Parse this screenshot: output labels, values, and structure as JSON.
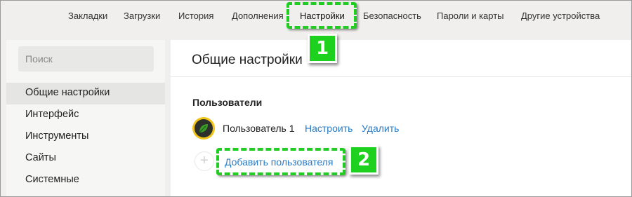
{
  "topnav": {
    "items": [
      "Закладки",
      "Загрузки",
      "История",
      "Дополнения",
      "Настройки",
      "Безопасность",
      "Пароли и карты",
      "Другие устройства"
    ],
    "active": "Настройки"
  },
  "sidebar": {
    "search_placeholder": "Поиск",
    "items": [
      "Общие настройки",
      "Интерфейс",
      "Инструменты",
      "Сайты",
      "Системные"
    ],
    "active": "Общие настройки"
  },
  "main": {
    "title": "Общие настройки",
    "users_section": {
      "title": "Пользователи",
      "user_name": "Пользователь 1",
      "configure_label": "Настроить",
      "delete_label": "Удалить",
      "add_user_label": "Добавить пользователя"
    }
  },
  "annotations": {
    "step1": "1",
    "step2": "2",
    "highlight_color": "#22cc22"
  },
  "colors": {
    "link": "#2a7bc4",
    "avatar_ring": "#f0c419",
    "leaf": "#3a9a2a"
  },
  "icons": [
    "leaf-avatar-icon",
    "plus-icon"
  ]
}
